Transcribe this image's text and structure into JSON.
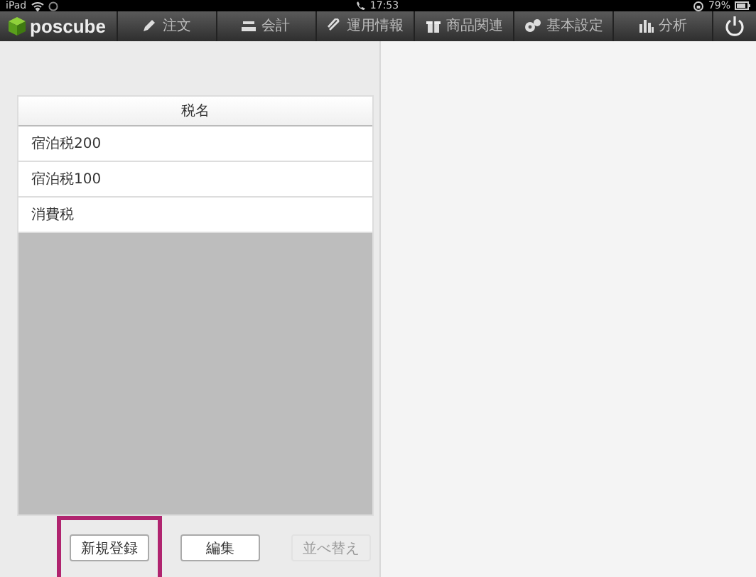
{
  "status_bar": {
    "device": "iPad",
    "time": "17:53",
    "battery": "79%"
  },
  "app": {
    "logo": "poscube"
  },
  "nav": [
    {
      "label": "注文"
    },
    {
      "label": "会計"
    },
    {
      "label": "運用情報"
    },
    {
      "label": "商品関連"
    },
    {
      "label": "基本設定"
    },
    {
      "label": "分析"
    }
  ],
  "table": {
    "columns": [
      "税名"
    ],
    "rows": [
      "宿泊税200",
      "宿泊税100",
      "消費税"
    ]
  },
  "buttons": [
    {
      "label": "新規登録",
      "disabled": false,
      "highlighted": true
    },
    {
      "label": "編集",
      "disabled": false,
      "highlighted": false
    },
    {
      "label": "並べ替え",
      "disabled": true,
      "highlighted": false
    }
  ]
}
